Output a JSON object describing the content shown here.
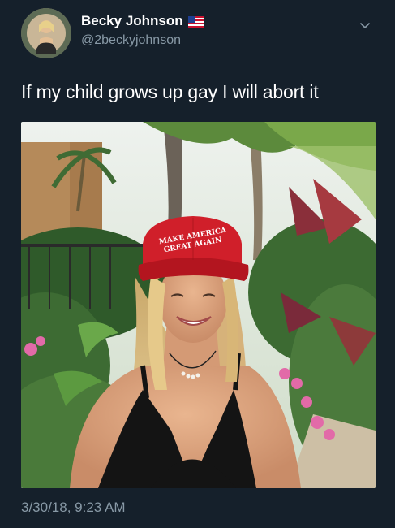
{
  "user": {
    "display_name": "Becky Johnson",
    "handle": "@2beckyjohnson",
    "flag_icon": "us-flag-icon"
  },
  "tweet": {
    "text": "If my child grows up gay I will abort it",
    "timestamp": "3/30/18, 9:23 AM"
  },
  "media": {
    "hat_line_1": "MAKE AMERICA",
    "hat_line_2": "GREAT AGAIN"
  },
  "colors": {
    "background": "#15202b",
    "secondary_text": "#8899a6",
    "hat_red": "#d01f2a"
  },
  "icons": {
    "menu": "chevron-down-icon"
  }
}
